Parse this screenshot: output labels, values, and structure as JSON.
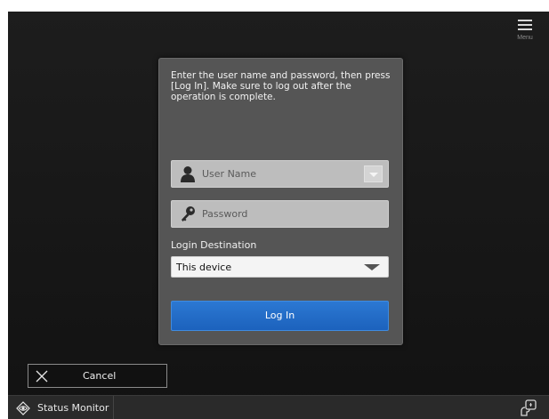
{
  "menu": {
    "label": "Menu"
  },
  "login": {
    "instructions": "Enter the user name and password, then press\n[Log In]. Make sure to log out after the\noperation is complete.",
    "username_placeholder": "User Name",
    "password_placeholder": "Password",
    "destination_label": "Login Destination",
    "destination_value": "This device",
    "login_button": "Log In"
  },
  "actions": {
    "cancel_label": "Cancel"
  },
  "bottom_bar": {
    "status_monitor_label": "Status Monitor"
  },
  "icons": {
    "menu": "hamburger-icon",
    "username": "user-icon",
    "password": "key-icon",
    "cancel": "close-icon",
    "status_monitor": "status-monitor-icon",
    "remote": "remote-operation-icon"
  },
  "colors": {
    "background": "#171717",
    "panel": "#555555",
    "login_button": "#1f66c2",
    "field": "#bdbdbd"
  }
}
